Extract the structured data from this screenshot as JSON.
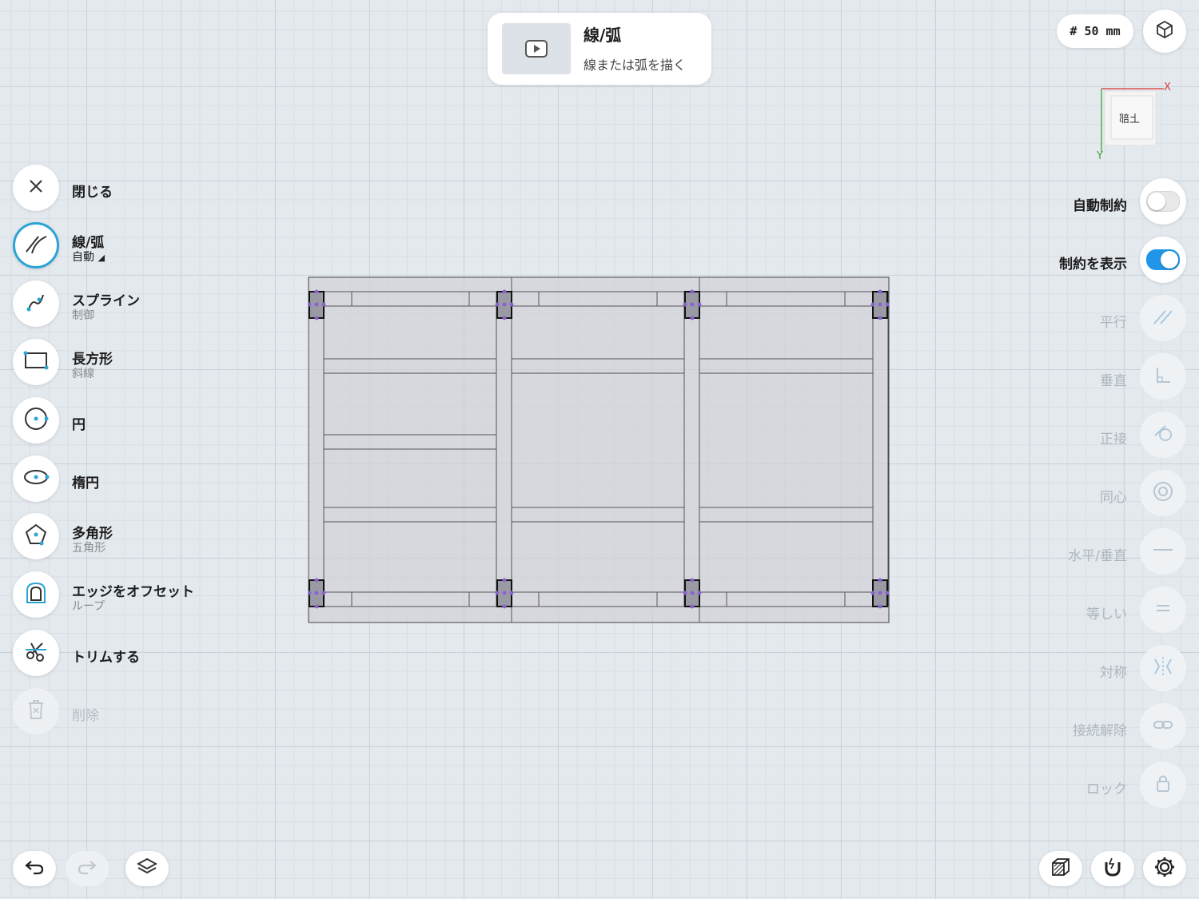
{
  "hint_card": {
    "title": "線/弧",
    "subtitle": "線または弧を描く"
  },
  "grid_size": {
    "label": "# 50 mm"
  },
  "view_cube": {
    "face_label": "上部",
    "axis_x": "X",
    "axis_y": "Y"
  },
  "left_tools": {
    "close": {
      "label": "閉じる"
    },
    "line_arc": {
      "label": "線/弧",
      "sub": "自動"
    },
    "spline": {
      "label": "スプライン",
      "sub": "制御"
    },
    "rectangle": {
      "label": "長方形",
      "sub": "斜線"
    },
    "circle": {
      "label": "円"
    },
    "ellipse": {
      "label": "楕円"
    },
    "polygon": {
      "label": "多角形",
      "sub": "五角形"
    },
    "offset_edge": {
      "label": "エッジをオフセット",
      "sub": "ループ"
    },
    "trim": {
      "label": "トリムする"
    },
    "delete": {
      "label": "削除"
    }
  },
  "constraints": {
    "auto_constraint": {
      "label": "自動制約",
      "on": false
    },
    "show_constraints": {
      "label": "制約を表示",
      "on": true
    },
    "parallel": {
      "label": "平行"
    },
    "perpendicular": {
      "label": "垂直"
    },
    "tangent": {
      "label": "正接"
    },
    "concentric": {
      "label": "同心"
    },
    "horizontal_vertical": {
      "label": "水平/垂直"
    },
    "equal": {
      "label": "等しい"
    },
    "symmetric": {
      "label": "対称"
    },
    "disconnect": {
      "label": "接続解除"
    },
    "lock": {
      "label": "ロック"
    }
  },
  "colors": {
    "accent": "#2ba4d6",
    "toggle_on": "#2196e8",
    "constraint_point": "#8a63d2"
  }
}
